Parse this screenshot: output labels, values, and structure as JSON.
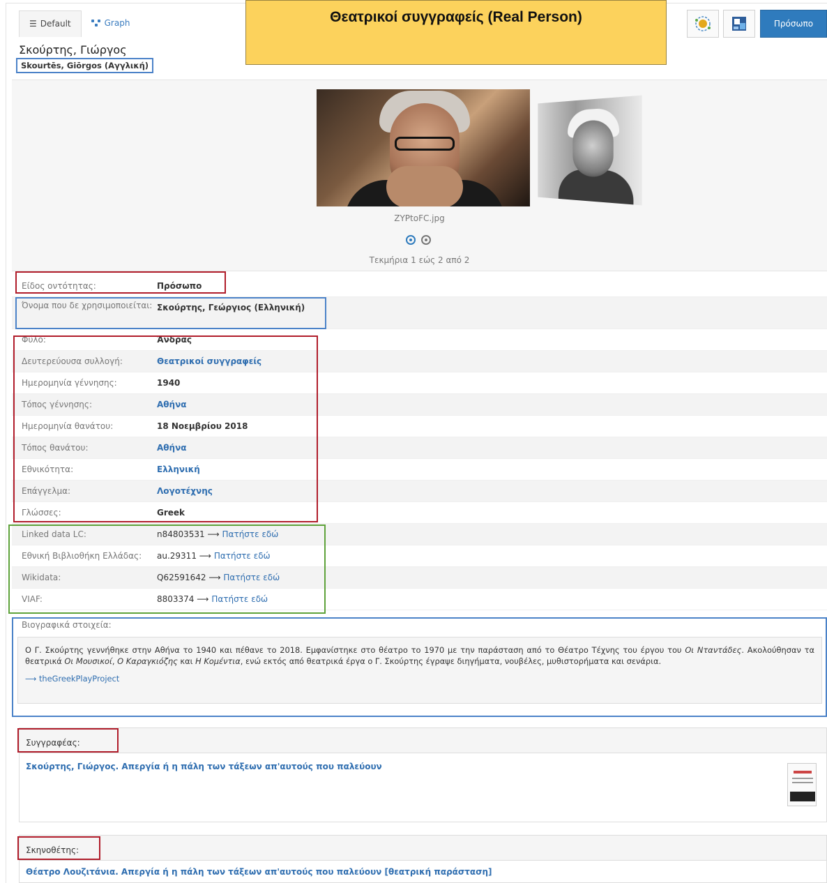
{
  "banner": {
    "title": "Θεατρικοί συγγραφείς (Real Person)"
  },
  "tabs": [
    {
      "label": "Default",
      "icon": "list-icon",
      "active": true
    },
    {
      "label": "Graph",
      "icon": "graph-icon",
      "active": false
    }
  ],
  "toolbar": {
    "icons": [
      "linked-data-icon",
      "export-icon"
    ],
    "primary_label": "Πρόσωπο",
    "accent": "#2f7bbd"
  },
  "person": {
    "name": "Σκούρτης, Γιώργος",
    "alt_name": "Skourtēs, Giōrgos (Αγγλική)"
  },
  "gallery": {
    "file_name": "ZYPtoFC.jpg",
    "count_text": "Τεκμήρια 1 εώς 2 από 2"
  },
  "fields": [
    {
      "label": "Είδος οντότητας:",
      "value": "Πρόσωπο"
    },
    {
      "label": "Όνομα που δε χρησιμοποιείται:",
      "value": "Σκούρτης, Γεώργιος (Ελληνική)"
    },
    {
      "label": "Φύλο:",
      "value": "Άνδρας"
    },
    {
      "label": "Δευτερεύουσα συλλογή:",
      "value": "Θεατρικοί συγγραφείς"
    },
    {
      "label": "Ημερομηνία γέννησης:",
      "value": "1940"
    },
    {
      "label": "Τόπος γέννησης:",
      "value": "Αθήνα"
    },
    {
      "label": "Ημερομηνία θανάτου:",
      "value": "18 Νοεμβρίου 2018"
    },
    {
      "label": "Τόπος θανάτου:",
      "value": "Αθήνα"
    },
    {
      "label": "Εθνικότητα:",
      "value": "Ελληνική"
    },
    {
      "label": "Επάγγελμα:",
      "value": "Λογοτέχνης"
    },
    {
      "label": "Γλώσσες:",
      "value": "Greek"
    }
  ],
  "linked": [
    {
      "label": "Linked data LC:",
      "id": "n84803531",
      "link": "Πατήστε εδώ"
    },
    {
      "label": "Εθνική Βιβλιοθήκη Ελλάδας:",
      "id": "au.29311",
      "link": "Πατήστε εδώ"
    },
    {
      "label": "Wikidata:",
      "id": "Q62591642",
      "link": "Πατήστε εδώ"
    },
    {
      "label": "VIAF:",
      "id": "8803374",
      "link": "Πατήστε εδώ"
    }
  ],
  "arrow": "⟶",
  "bio": {
    "label": "Βιογραφικά στοιχεία:",
    "p1": "Ο Γ. Σκούρτης γεννήθηκε στην Αθήνα το 1940 και πέθανε το 2018. Εμφανίστηκε στο θέατρο το 1970 με την παράσταση από το Θέατρο Τέχνης του έργου του ",
    "w1": "Οι Νταντάδες",
    "p2": ". Ακολούθησαν τα θεατρικά ",
    "w2": "Οι Μουσικοί",
    "p3": ", ",
    "w3": "Ο Καραγκιόζης",
    "p4": " και ",
    "w4": "Η Κομέντια",
    "p5": ", ενώ εκτός από θεατρικά έργα ο Γ. Σκούρτης έγραψε διηγήματα, νουβέλες, μυθιστορήματα και σενάρια.",
    "source": "theGreekPlayProject"
  },
  "author": {
    "label": "Συγγραφέας:",
    "work": "Σκούρτης, Γιώργος. Απεργία ή η πάλη των τάξεων απ'αυτούς που παλεύουν"
  },
  "director": {
    "label": "Σκηνοθέτης:",
    "work": "Θέατρο Λουζιτάνια. Απεργία ή η πάλη των τάξεων απ'αυτούς που παλεύουν [θεατρική παράσταση]"
  }
}
